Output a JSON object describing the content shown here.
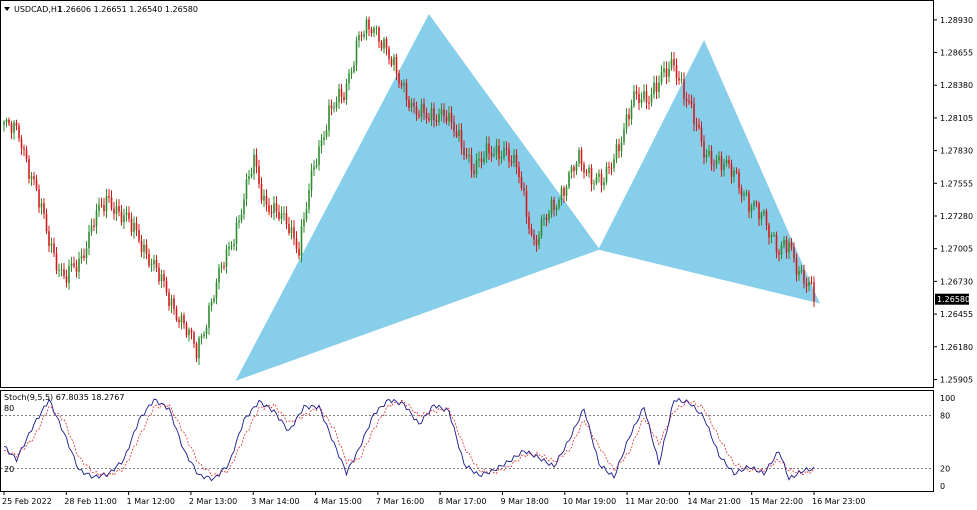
{
  "header": {
    "symbol": "USDCAD,H1",
    "ohlc": "1.26606 1.26651 1.26540 1.26580",
    "menu_icon": "triangle-down-icon"
  },
  "indicator": {
    "label": "Stoch(9,5,5) 67.8035 18.2767",
    "level_high": "80",
    "level_low": "20"
  },
  "colors": {
    "bull": "#2e8b2e",
    "bear": "#d11a1a",
    "pattern_fill": "#87ceeb",
    "stoch_main": "#1a1a8c",
    "stoch_signal": "#e03030",
    "price_tag_bg": "#000000",
    "price_tag_fg": "#ffffff"
  },
  "chart_data": {
    "type": "candlestick",
    "price_ticks": [
      "1.28930",
      "1.28655",
      "1.28380",
      "1.28105",
      "1.27830",
      "1.27555",
      "1.27280",
      "1.27005",
      "1.26730",
      "1.26455",
      "1.26180",
      "1.25905"
    ],
    "current_price": "1.26580",
    "ylim": [
      1.2585,
      1.2908
    ],
    "time_labels": [
      "25 Feb 2022",
      "28 Feb 11:00",
      "1 Mar 12:00",
      "2 Mar 13:00",
      "3 Mar 14:00",
      "4 Mar 15:00",
      "7 Mar 16:00",
      "8 Mar 17:00",
      "9 Mar 18:00",
      "10 Mar 19:00",
      "11 Mar 20:00",
      "14 Mar 21:00",
      "15 Mar 22:00",
      "16 Mar 23:00"
    ],
    "anchors": [
      [
        0,
        1.2805
      ],
      [
        6,
        1.2797
      ],
      [
        12,
        1.2755
      ],
      [
        18,
        1.2708
      ],
      [
        24,
        1.2675
      ],
      [
        30,
        1.2688
      ],
      [
        36,
        1.2725
      ],
      [
        42,
        1.2742
      ],
      [
        48,
        1.2727
      ],
      [
        54,
        1.271
      ],
      [
        60,
        1.2685
      ],
      [
        66,
        1.266
      ],
      [
        72,
        1.2635
      ],
      [
        77,
        1.2615
      ],
      [
        82,
        1.2648
      ],
      [
        88,
        1.269
      ],
      [
        94,
        1.2725
      ],
      [
        100,
        1.2775
      ],
      [
        104,
        1.2742
      ],
      [
        108,
        1.273
      ],
      [
        114,
        1.2722
      ],
      [
        118,
        1.27
      ],
      [
        124,
        1.277
      ],
      [
        130,
        1.2815
      ],
      [
        136,
        1.283
      ],
      [
        142,
        1.288
      ],
      [
        148,
        1.2885
      ],
      [
        152,
        1.2875
      ],
      [
        158,
        1.284
      ],
      [
        164,
        1.282
      ],
      [
        170,
        1.2808
      ],
      [
        176,
        1.2818
      ],
      [
        182,
        1.279
      ],
      [
        188,
        1.277
      ],
      [
        194,
        1.278
      ],
      [
        200,
        1.2785
      ],
      [
        206,
        1.2762
      ],
      [
        212,
        1.2705
      ],
      [
        218,
        1.273
      ],
      [
        224,
        1.2752
      ],
      [
        230,
        1.2775
      ],
      [
        236,
        1.276
      ],
      [
        240,
        1.2755
      ],
      [
        246,
        1.279
      ],
      [
        252,
        1.2825
      ],
      [
        258,
        1.283
      ],
      [
        264,
        1.2845
      ],
      [
        268,
        1.2858
      ],
      [
        274,
        1.282
      ],
      [
        280,
        1.2785
      ],
      [
        286,
        1.277
      ],
      [
        292,
        1.2768
      ],
      [
        298,
        1.2735
      ],
      [
        304,
        1.273
      ],
      [
        310,
        1.2695
      ],
      [
        314,
        1.2705
      ],
      [
        318,
        1.2683
      ],
      [
        322,
        1.2667
      ],
      [
        324,
        1.266
      ]
    ],
    "pattern": [
      [
        93,
        1.259
      ],
      [
        170,
        1.2897
      ],
      [
        238,
        1.27
      ],
      [
        280,
        1.2875
      ],
      [
        326,
        1.2655
      ]
    ],
    "stoch": {
      "ylim": [
        0,
        100
      ],
      "levels": [
        80,
        20
      ],
      "ticks": [
        "100",
        "80",
        "20",
        "0"
      ],
      "main": [
        [
          0,
          45
        ],
        [
          5,
          30
        ],
        [
          12,
          70
        ],
        [
          18,
          98
        ],
        [
          24,
          60
        ],
        [
          30,
          18
        ],
        [
          36,
          10
        ],
        [
          42,
          14
        ],
        [
          48,
          30
        ],
        [
          54,
          75
        ],
        [
          60,
          98
        ],
        [
          66,
          88
        ],
        [
          72,
          40
        ],
        [
          78,
          12
        ],
        [
          84,
          8
        ],
        [
          90,
          25
        ],
        [
          96,
          75
        ],
        [
          102,
          96
        ],
        [
          108,
          85
        ],
        [
          114,
          62
        ],
        [
          120,
          90
        ],
        [
          126,
          90
        ],
        [
          132,
          48
        ],
        [
          137,
          15
        ],
        [
          142,
          42
        ],
        [
          148,
          82
        ],
        [
          154,
          98
        ],
        [
          160,
          93
        ],
        [
          166,
          70
        ],
        [
          172,
          92
        ],
        [
          178,
          85
        ],
        [
          184,
          25
        ],
        [
          190,
          12
        ],
        [
          196,
          18
        ],
        [
          202,
          28
        ],
        [
          208,
          40
        ],
        [
          214,
          32
        ],
        [
          220,
          22
        ],
        [
          226,
          52
        ],
        [
          232,
          88
        ],
        [
          238,
          25
        ],
        [
          244,
          10
        ],
        [
          250,
          55
        ],
        [
          256,
          90
        ],
        [
          262,
          25
        ],
        [
          268,
          98
        ],
        [
          274,
          95
        ],
        [
          280,
          78
        ],
        [
          286,
          35
        ],
        [
          292,
          14
        ],
        [
          298,
          22
        ],
        [
          304,
          14
        ],
        [
          310,
          40
        ],
        [
          314,
          8
        ],
        [
          320,
          18
        ],
        [
          326,
          20
        ]
      ],
      "signal": [
        [
          0,
          40
        ],
        [
          5,
          35
        ],
        [
          12,
          55
        ],
        [
          18,
          90
        ],
        [
          24,
          75
        ],
        [
          30,
          32
        ],
        [
          36,
          15
        ],
        [
          42,
          12
        ],
        [
          48,
          20
        ],
        [
          54,
          55
        ],
        [
          60,
          90
        ],
        [
          66,
          92
        ],
        [
          72,
          60
        ],
        [
          78,
          25
        ],
        [
          84,
          12
        ],
        [
          90,
          18
        ],
        [
          96,
          55
        ],
        [
          102,
          88
        ],
        [
          108,
          92
        ],
        [
          114,
          72
        ],
        [
          120,
          80
        ],
        [
          126,
          90
        ],
        [
          132,
          65
        ],
        [
          137,
          28
        ],
        [
          142,
          30
        ],
        [
          148,
          65
        ],
        [
          154,
          92
        ],
        [
          160,
          96
        ],
        [
          166,
          80
        ],
        [
          172,
          85
        ],
        [
          178,
          88
        ],
        [
          184,
          45
        ],
        [
          190,
          18
        ],
        [
          196,
          15
        ],
        [
          202,
          22
        ],
        [
          208,
          35
        ],
        [
          214,
          36
        ],
        [
          220,
          28
        ],
        [
          226,
          40
        ],
        [
          232,
          75
        ],
        [
          238,
          45
        ],
        [
          244,
          18
        ],
        [
          250,
          38
        ],
        [
          256,
          78
        ],
        [
          262,
          48
        ],
        [
          268,
          85
        ],
        [
          274,
          97
        ],
        [
          280,
          88
        ],
        [
          286,
          55
        ],
        [
          292,
          25
        ],
        [
          298,
          18
        ],
        [
          304,
          18
        ],
        [
          310,
          30
        ],
        [
          314,
          18
        ],
        [
          320,
          14
        ],
        [
          326,
          19
        ]
      ]
    }
  }
}
